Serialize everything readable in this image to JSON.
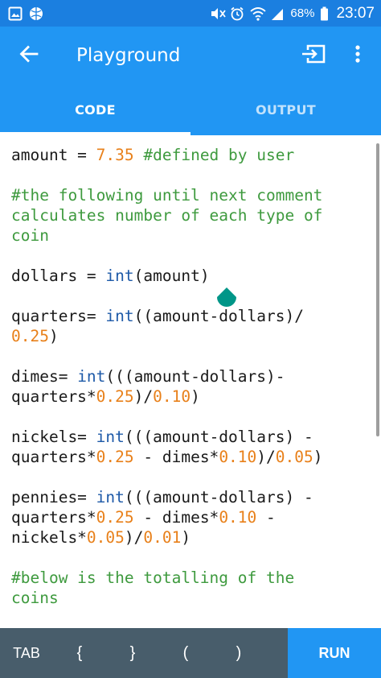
{
  "status_bar": {
    "battery": "68%",
    "time": "23:07",
    "icons": [
      "gallery-icon",
      "ball-icon",
      "mute-icon",
      "alarm-icon",
      "wifi-icon",
      "signal-icon",
      "battery-icon"
    ]
  },
  "app_bar": {
    "title": "Playground",
    "back_icon": "arrow-back-icon",
    "actions": [
      "input-icon",
      "more-vert-icon"
    ]
  },
  "tabs": [
    {
      "label": "CODE",
      "active": true
    },
    {
      "label": "OUTPUT",
      "active": false
    }
  ],
  "code": {
    "lines": [
      [
        {
          "t": "amount = ",
          "c": "plain"
        },
        {
          "t": "7.35",
          "c": "num"
        },
        {
          "t": " #defined by user",
          "c": "com"
        }
      ],
      [],
      [
        {
          "t": "#the following until next comment",
          "c": "com"
        }
      ],
      [
        {
          "t": "calculates number of each type of",
          "c": "com"
        }
      ],
      [
        {
          "t": "coin",
          "c": "com"
        }
      ],
      [],
      [
        {
          "t": "dollars = ",
          "c": "plain"
        },
        {
          "t": "int",
          "c": "kw"
        },
        {
          "t": "(amount)",
          "c": "plain"
        }
      ],
      [],
      [
        {
          "t": "quarters= ",
          "c": "plain"
        },
        {
          "t": "int",
          "c": "kw"
        },
        {
          "t": "((amount-dollars)/",
          "c": "plain"
        }
      ],
      [
        {
          "t": "0.25",
          "c": "num"
        },
        {
          "t": ")",
          "c": "plain"
        }
      ],
      [],
      [
        {
          "t": "dimes= ",
          "c": "plain"
        },
        {
          "t": "int",
          "c": "kw"
        },
        {
          "t": "(((amount-dollars)-",
          "c": "plain"
        }
      ],
      [
        {
          "t": "quarters*",
          "c": "plain"
        },
        {
          "t": "0.25",
          "c": "num"
        },
        {
          "t": ")/",
          "c": "plain"
        },
        {
          "t": "0.10",
          "c": "num"
        },
        {
          "t": ")",
          "c": "plain"
        }
      ],
      [],
      [
        {
          "t": "nickels= ",
          "c": "plain"
        },
        {
          "t": "int",
          "c": "kw"
        },
        {
          "t": "(((amount-dollars) -",
          "c": "plain"
        }
      ],
      [
        {
          "t": "quarters*",
          "c": "plain"
        },
        {
          "t": "0.25",
          "c": "num"
        },
        {
          "t": " - dimes*",
          "c": "plain"
        },
        {
          "t": "0.10",
          "c": "num"
        },
        {
          "t": ")/",
          "c": "plain"
        },
        {
          "t": "0.05",
          "c": "num"
        },
        {
          "t": ")",
          "c": "plain"
        }
      ],
      [],
      [
        {
          "t": "pennies= ",
          "c": "plain"
        },
        {
          "t": "int",
          "c": "kw"
        },
        {
          "t": "(((amount-dollars) -",
          "c": "plain"
        }
      ],
      [
        {
          "t": "quarters*",
          "c": "plain"
        },
        {
          "t": "0.25",
          "c": "num"
        },
        {
          "t": " - dimes*",
          "c": "plain"
        },
        {
          "t": "0.10",
          "c": "num"
        },
        {
          "t": " -",
          "c": "plain"
        }
      ],
      [
        {
          "t": "nickels*",
          "c": "plain"
        },
        {
          "t": "0.05",
          "c": "num"
        },
        {
          "t": ")/",
          "c": "plain"
        },
        {
          "t": "0.01",
          "c": "num"
        },
        {
          "t": ")",
          "c": "plain"
        }
      ],
      [],
      [
        {
          "t": "#below is the totalling of the",
          "c": "com"
        }
      ],
      [
        {
          "t": "coins",
          "c": "com"
        }
      ]
    ]
  },
  "keyboard_bar": {
    "keys": [
      "TAB",
      "{",
      "}",
      "(",
      ")"
    ],
    "run_label": "RUN"
  },
  "colors": {
    "status_bar": "#1b7fe0",
    "app_bar": "#2196f3",
    "keyword": "#1e5aa8",
    "number": "#e8801a",
    "comment": "#3e9a3e",
    "key_row": "#485d6b",
    "cursor_handle": "#009688"
  }
}
